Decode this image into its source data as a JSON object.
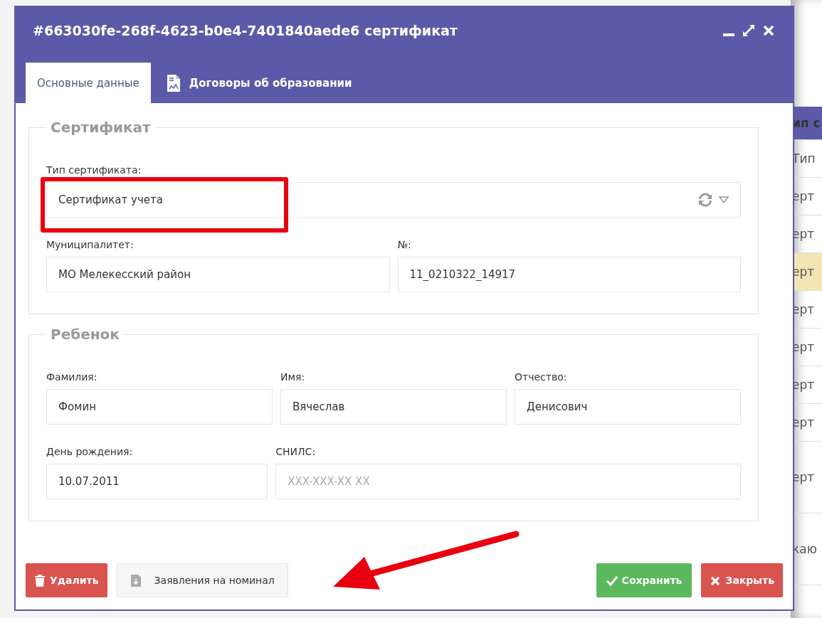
{
  "window": {
    "title": "#663030fe-268f-4623-b0e4-7401840aede6 сертификат",
    "controls": [
      {
        "kind": "minimize"
      },
      {
        "kind": "maximize"
      },
      {
        "kind": "close"
      }
    ]
  },
  "tabs": [
    {
      "label": "Основные данные",
      "selected": true,
      "icon": false
    },
    {
      "label": "Договоры об образовании",
      "selected": false,
      "icon": true
    }
  ],
  "sections": [
    {
      "legend": "Сертификат",
      "rows": [
        [
          {
            "label": "Тип сертификата:",
            "value": "Сертификат учета",
            "kind": "select",
            "highlighted": true
          }
        ],
        [
          {
            "label": "Муниципалитет:",
            "value": "МО Мелекесский район",
            "kind": "text"
          },
          {
            "label": "№:",
            "value": "11_0210322_14917",
            "kind": "text"
          }
        ]
      ]
    },
    {
      "legend": "Ребенок",
      "rows": [
        [
          {
            "label": "Фамилия:",
            "value": "Фомин",
            "kind": "text"
          },
          {
            "label": "Имя:",
            "value": "Вячеслав",
            "kind": "text"
          },
          {
            "label": "Отчество:",
            "value": "Денисович",
            "kind": "text"
          }
        ],
        [
          {
            "label": "День рождения:",
            "value": "10.07.2011",
            "kind": "text"
          },
          {
            "label": "СНИЛС:",
            "placeholder": "XXX-XXX-XX XX",
            "kind": "text"
          }
        ]
      ]
    }
  ],
  "buttons": [
    {
      "label": "Удалить",
      "kind": "delete"
    },
    {
      "label": "Заявления на номинал",
      "kind": "document"
    },
    {
      "label": "Сохранить",
      "kind": "save"
    },
    {
      "label": "Закрыть",
      "kind": "close"
    }
  ],
  "annotation": {
    "kind": "arrow"
  },
  "background_table": {
    "header": "ип с",
    "rows": [
      {
        "text": "Тип",
        "selected": false
      },
      {
        "text": "ерт",
        "selected": false
      },
      {
        "text": "ерт",
        "selected": false
      },
      {
        "text": "ерт",
        "selected": true
      },
      {
        "text": "ерт",
        "selected": false
      },
      {
        "text": "ерт",
        "selected": false
      },
      {
        "text": "ерт",
        "selected": false
      },
      {
        "text": "ерт",
        "selected": false
      },
      {
        "text": "ерт",
        "selected": false,
        "tall": true
      },
      {
        "text": "каю",
        "selected": false,
        "tall": true
      }
    ]
  }
}
